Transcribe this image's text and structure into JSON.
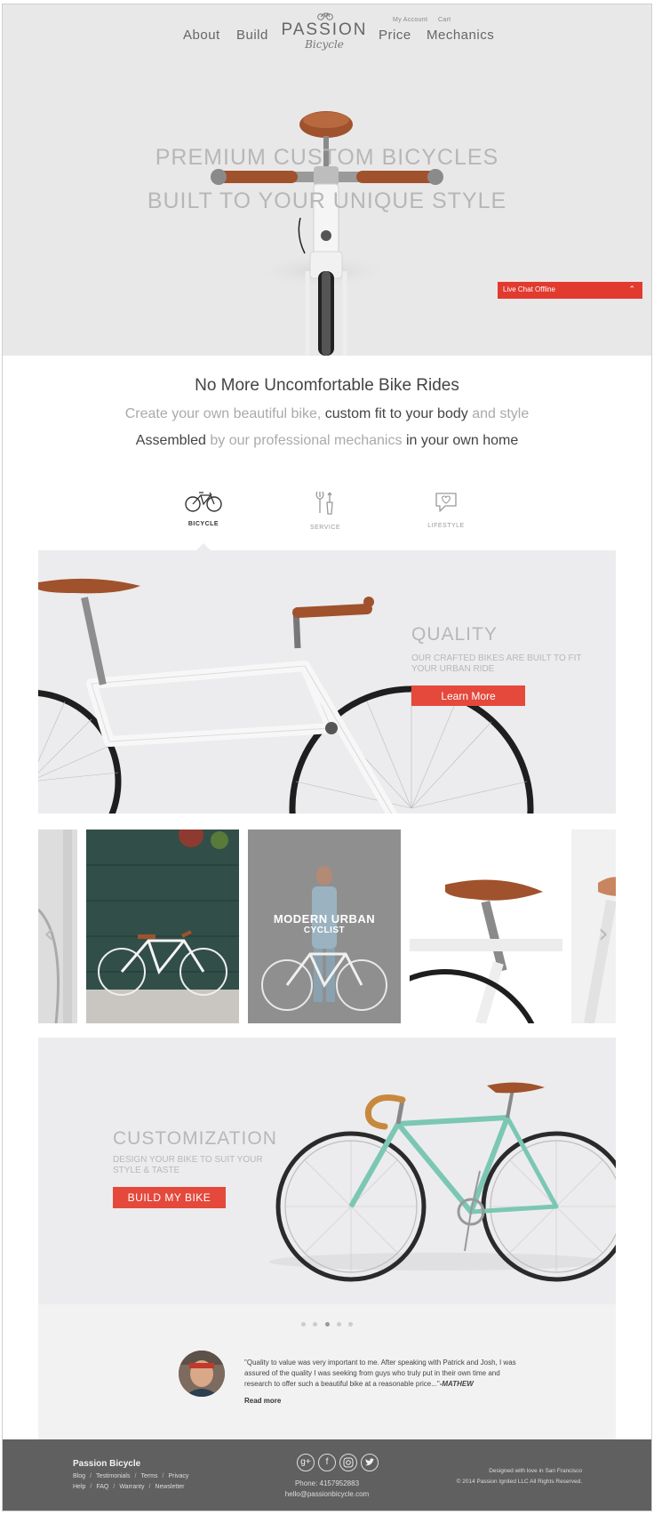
{
  "nav": {
    "left": [
      "About",
      "Build"
    ],
    "right": [
      "Price",
      "Mechanics"
    ],
    "account": "My Account",
    "cart": "Cart",
    "logo_main": "PASSION",
    "logo_script": "Bicycle"
  },
  "hero": {
    "line1": "PREMIUM CUSTOM BICYCLES",
    "line2": "BUILT TO YOUR UNIQUE STYLE"
  },
  "chat": {
    "label": "Live Chat Offline"
  },
  "intro": {
    "heading": "No More Uncomfortable Bike Rides",
    "line2_a": "Create your own beautiful bike,",
    "line2_b": "custom fit to your body",
    "line2_c": "and style",
    "line3_a": "Assembled",
    "line3_b": "by our professional mechanics",
    "line3_c": "in your own home"
  },
  "tabs": [
    {
      "label": "BICYCLE",
      "icon": "bicycle-icon",
      "active": true
    },
    {
      "label": "SERVICE",
      "icon": "tools-icon",
      "active": false
    },
    {
      "label": "LIFESTYLE",
      "icon": "speech-heart-icon",
      "active": false
    }
  ],
  "quality": {
    "title": "QUALITY",
    "subtitle": "OUR CRAFTED BIKES ARE BUILT TO FIT YOUR URBAN RIDE",
    "button": "Learn More"
  },
  "carousel": {
    "caption_line1": "MODERN URBAN",
    "caption_line2": "CYCLIST"
  },
  "customization": {
    "title": "CUSTOMIZATION",
    "subtitle": "DESIGN YOUR BIKE TO SUIT YOUR STYLE & TASTE",
    "button": "BUILD MY BIKE"
  },
  "testimonial": {
    "quote": "\"Quality to value was very important to me. After speaking with Patrick and Josh, I was assured of the quality I was seeking from guys who truly put in their own time and research to offer such a beautiful bike at a reasonable price...\"",
    "author": "-MATHEW",
    "read_more": "Read more",
    "dots_total": 5,
    "dots_active": 3
  },
  "footer": {
    "brand": "Passion Bicycle",
    "links_row1": [
      "Blog",
      "Testimonials",
      "Terms",
      "Privacy"
    ],
    "links_row2": [
      "Help",
      "FAQ",
      "Warranty",
      "Newsletter"
    ],
    "social": [
      "g+",
      "f",
      "instagram-icon",
      "twitter-icon"
    ],
    "phone": "Phone: 4157952883",
    "email": "hello@passionbicycle.com",
    "credit": "Designed with love in San Francisco",
    "copyright": "© 2014 Passion Ignited LLC All Rights Reserved."
  },
  "colors": {
    "accent": "#e4493c",
    "hero_bg": "#e9e8e9",
    "footer_bg": "#606060",
    "frame_mint": "#7cc7b4",
    "saddle_brown": "#a0522d"
  }
}
